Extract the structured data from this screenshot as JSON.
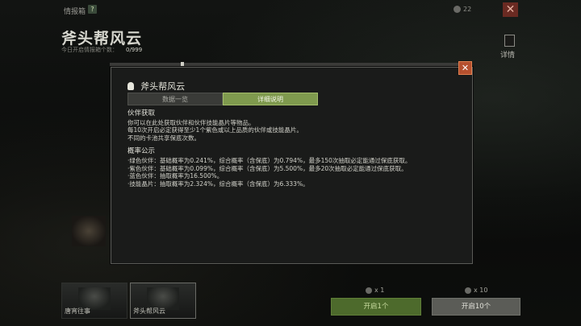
{
  "topbar": {
    "title": "情报箱",
    "help_icon": "?",
    "currency_value": "22",
    "close_glyph": "✕"
  },
  "banner": {
    "name": "斧头帮风云",
    "count_label": "今日开启情报箱个数：",
    "count_value": "0/999",
    "side_label": "详情"
  },
  "dialog": {
    "close_glyph": "✕",
    "title": "斧头帮风云",
    "tabs": [
      "数据一览",
      "详细说明"
    ],
    "active_tab": 1,
    "section1_heading": "伙伴获取",
    "section1_lines": [
      "你可以在此处获取伙伴和伙伴技能晶片等物品。",
      "每10次开启必定获得至少1个紫色或以上品质的伙伴或技能晶片。",
      "不同的卡池共享保底次数。"
    ],
    "section2_heading": "概率公示",
    "section2_lines": [
      "·绿色伙伴：基础概率为0.241%，综合概率（含保底）为0.794%，最多150次抽取必定能通过保底获取。",
      "·紫色伙伴：基础概率为0.099%，综合概率（含保底）为5.500%，最多20次抽取必定能通过保底获取。",
      "·蓝色伙伴：抽取概率为16.500%。",
      "·技能晶片：抽取概率为2.324%，综合概率（含保底）为6.333%。"
    ]
  },
  "bottom": {
    "cards": [
      "唐宵往事",
      "斧头帮风云"
    ],
    "ticket_1": "x 1",
    "ticket_10": "x 10",
    "open_1_label": "开启1个",
    "open_10_label": "开启10个"
  },
  "colors": {
    "accent_green": "#7f9a4e",
    "close_orange": "#b5502e",
    "button_green": "#4d6a2c"
  },
  "icons": [
    "help-icon",
    "coin-icon",
    "close-icon",
    "skull-icon",
    "detail-icon"
  ]
}
